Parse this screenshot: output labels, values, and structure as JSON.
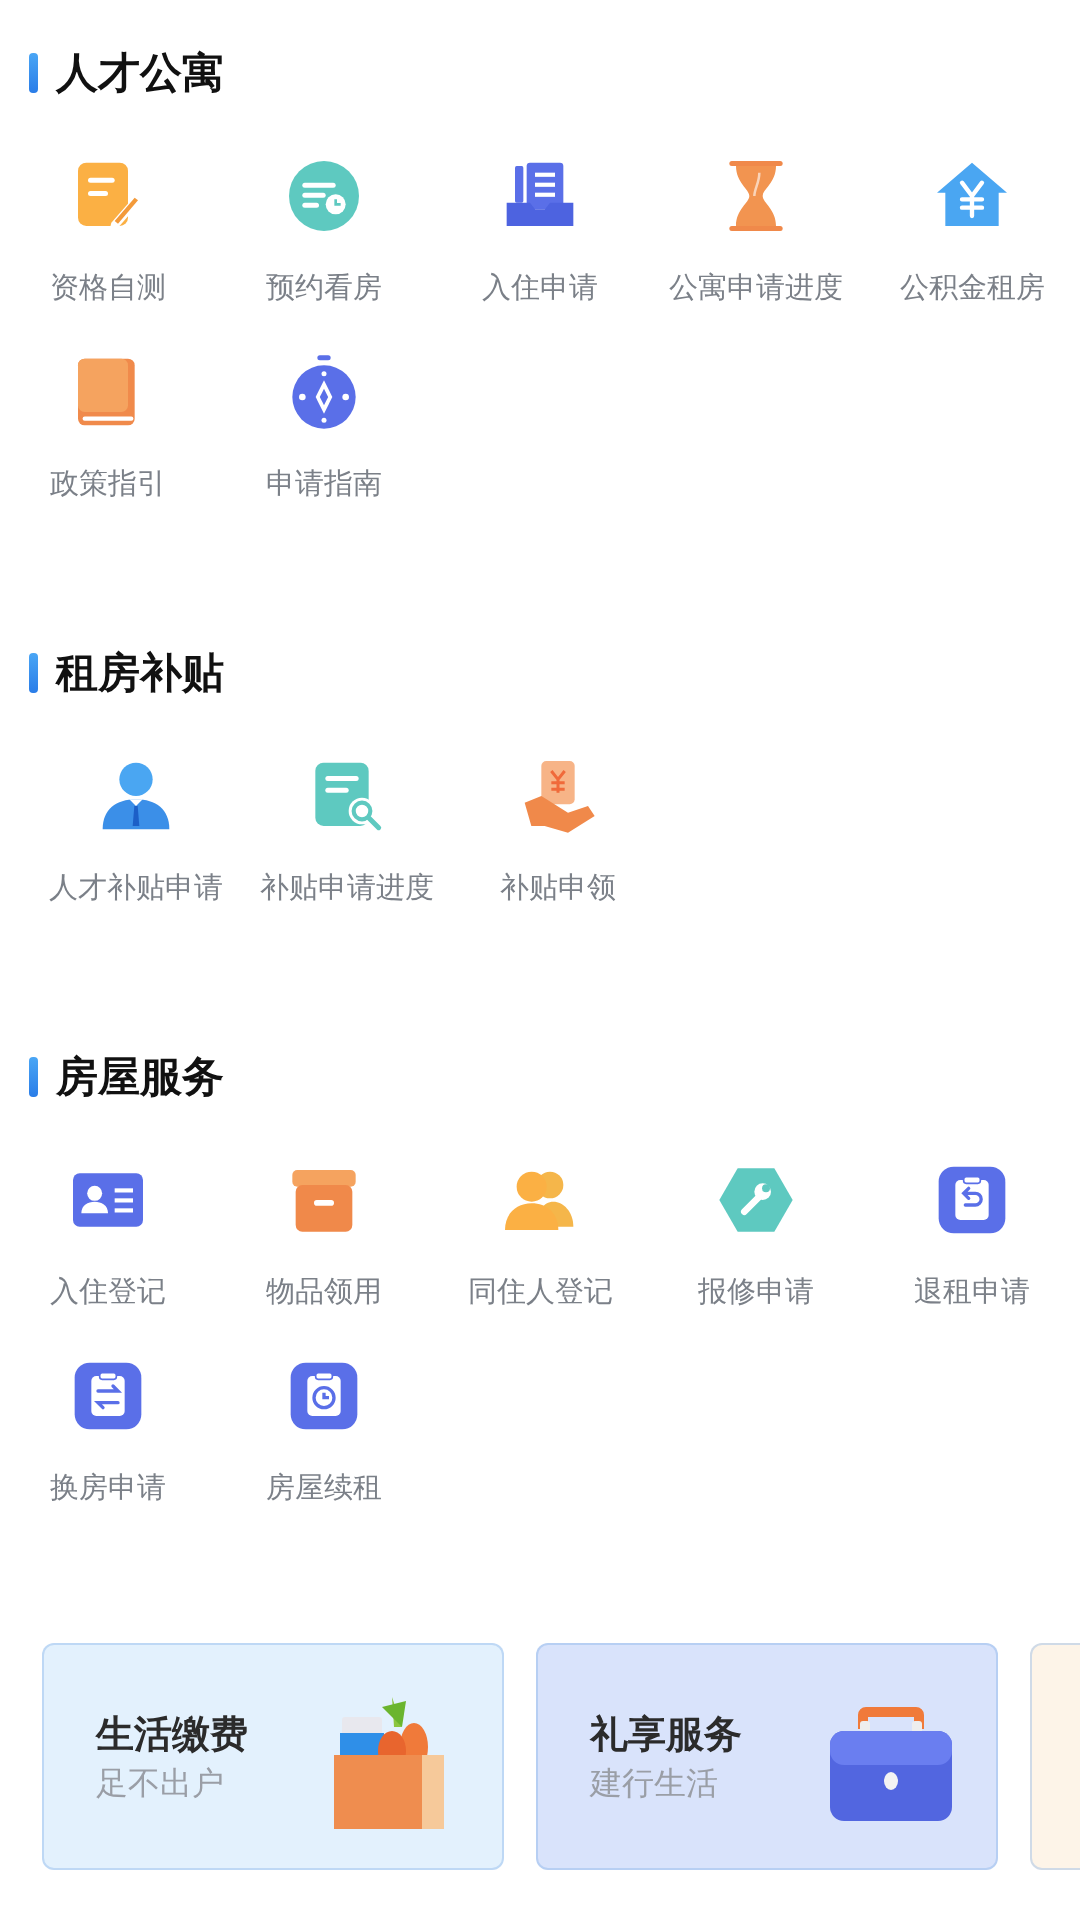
{
  "sections": [
    {
      "title": "人才公寓",
      "items": [
        {
          "label": "资格自测",
          "kind": "form"
        },
        {
          "label": "预约看房",
          "kind": "schedule"
        },
        {
          "label": "入住申请",
          "kind": "tray"
        },
        {
          "label": "公寓申请进度",
          "kind": "hourglass"
        },
        {
          "label": "公积金租房",
          "kind": "house"
        },
        {
          "label": "政策指引",
          "kind": "book"
        },
        {
          "label": "申请指南",
          "kind": "compass"
        }
      ]
    },
    {
      "title": "租房补贴",
      "items": [
        {
          "label": "人才补贴申请",
          "kind": "person"
        },
        {
          "label": "补贴申请进度",
          "kind": "docsearch"
        },
        {
          "label": "补贴申领",
          "kind": "hand"
        }
      ]
    },
    {
      "title": "房屋服务",
      "items": [
        {
          "label": "入住登记",
          "kind": "idcard"
        },
        {
          "label": "物品领用",
          "kind": "box"
        },
        {
          "label": "同住人登记",
          "kind": "people"
        },
        {
          "label": "报修申请",
          "kind": "wrench"
        },
        {
          "label": "退租申请",
          "kind": "clipreturn"
        },
        {
          "label": "换房申请",
          "kind": "clipswap"
        },
        {
          "label": "房屋续租",
          "kind": "clipclock"
        }
      ]
    }
  ],
  "cards": [
    {
      "title": "生活缴费",
      "subtitle": "足不出户",
      "kind": "groceries",
      "color": "#e3f1fd"
    },
    {
      "title": "礼享服务",
      "subtitle": "建行生活",
      "kind": "briefcase",
      "color": "#d9e3fb"
    },
    {
      "color": "#fdf4e8"
    }
  ]
}
